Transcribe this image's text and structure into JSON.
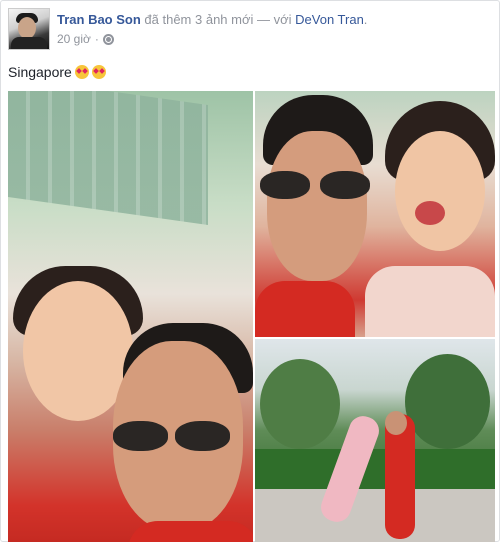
{
  "post": {
    "author": "Tran Bao Son",
    "action_text": " đã thêm 3 ảnh mới — với ",
    "tagged_person": "DeVon Tran",
    "trailing": ".",
    "timestamp": "20 giờ",
    "separator": "·",
    "message": "Singapore",
    "emoji_count": 2,
    "colors": {
      "link": "#365899",
      "meta": "#90949c",
      "text": "#1d2129"
    },
    "icons": [
      "globe-icon",
      "star-struck-emoji-icon"
    ]
  }
}
